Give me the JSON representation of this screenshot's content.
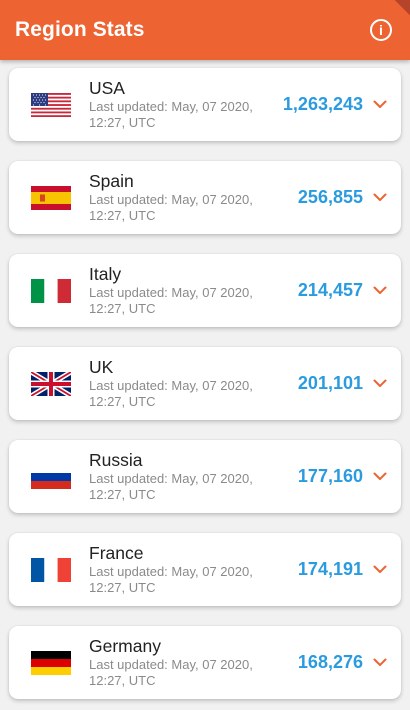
{
  "app": {
    "title": "Region Stats",
    "info_icon": "info-icon",
    "accent_color": "#ed6332",
    "count_color": "#2b9be0"
  },
  "regions": [
    {
      "name": "USA",
      "updated": "Last updated: May, 07 2020, 12:27, UTC",
      "count": "1,263,243",
      "flag_icon": "usa-flag-icon"
    },
    {
      "name": "Spain",
      "updated": "Last updated: May, 07 2020, 12:27, UTC",
      "count": "256,855",
      "flag_icon": "spain-flag-icon"
    },
    {
      "name": "Italy",
      "updated": "Last updated: May, 07 2020, 12:27, UTC",
      "count": "214,457",
      "flag_icon": "italy-flag-icon"
    },
    {
      "name": "UK",
      "updated": "Last updated: May, 07 2020, 12:27, UTC",
      "count": "201,101",
      "flag_icon": "uk-flag-icon"
    },
    {
      "name": "Russia",
      "updated": "Last updated: May, 07 2020, 12:27, UTC",
      "count": "177,160",
      "flag_icon": "russia-flag-icon"
    },
    {
      "name": "France",
      "updated": "Last updated: May, 07 2020, 12:27, UTC",
      "count": "174,191",
      "flag_icon": "france-flag-icon"
    },
    {
      "name": "Germany",
      "updated": "Last updated: May, 07 2020, 12:27, UTC",
      "count": "168,276",
      "flag_icon": "germany-flag-icon"
    }
  ]
}
